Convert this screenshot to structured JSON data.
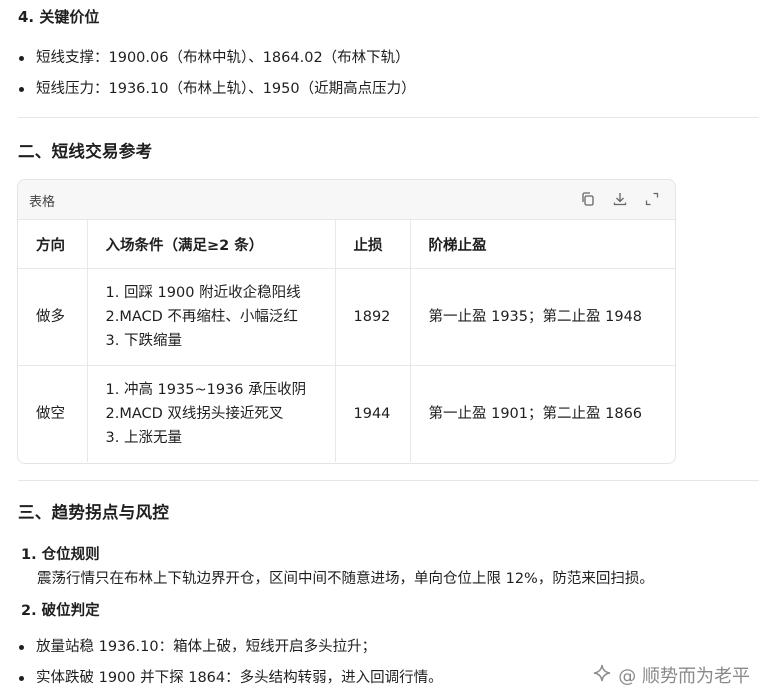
{
  "section4": {
    "title": "4. 关键价位",
    "bullets": [
      "短线支撑：1900.06（布林中轨）、1864.02（布林下轨）",
      "短线压力：1936.10（布林上轨）、1950（近期高点压力）"
    ]
  },
  "section2": {
    "title": "二、短线交易参考",
    "table": {
      "label": "表格",
      "toolbar": {
        "copy_icon": "copy-icon",
        "download_icon": "download-icon",
        "expand_icon": "expand-icon"
      },
      "headers": [
        "方向",
        "入场条件（满足≥2 条）",
        "止损",
        "阶梯止盈"
      ],
      "rows": [
        {
          "direction": "做多",
          "conditions": [
            "1. 回踩 1900 附近收企稳阳线",
            "2.MACD 不再缩柱、小幅泛红",
            "3. 下跌缩量"
          ],
          "stop_loss": "1892",
          "take_profit": "第一止盈 1935；第二止盈 1948"
        },
        {
          "direction": "做空",
          "conditions": [
            "1. 冲高 1935~1936 承压收阴",
            "2.MACD 双线拐头接近死叉",
            "3. 上涨无量"
          ],
          "stop_loss": "1944",
          "take_profit": "第一止盈 1901；第二止盈 1866"
        }
      ]
    }
  },
  "section3": {
    "title": "三、趋势拐点与风控",
    "items": [
      {
        "title": "1. 仓位规则",
        "text": "震荡行情只在布林上下轨边界开仓，区间中间不随意进场，单向仓位上限 12%，防范来回扫损。"
      },
      {
        "title": "2. 破位判定"
      }
    ],
    "bullets": [
      "放量站稳 1936.10：箱体上破，短线开启多头拉升；",
      "实体跌破 1900 并下探 1864：多头结构转弱，进入回调行情。"
    ]
  },
  "watermark": {
    "text": "@ 顺势而为老平",
    "icon": "sparkle-icon"
  }
}
